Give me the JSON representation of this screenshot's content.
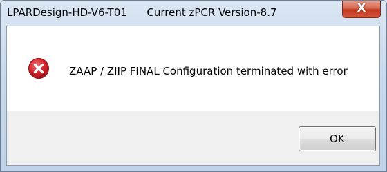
{
  "window": {
    "title": "LPARDesign-HD-V6-T01      Current zPCR Version-8.7",
    "close_glyph": "X",
    "close_icon": "close-icon"
  },
  "dialog": {
    "icon": "error-icon",
    "message": "ZAAP / ZIIP FINAL Configuration terminated with error",
    "ok_label": "OK"
  },
  "colors": {
    "error_red": "#d3232b",
    "close_red": "#c23a1e"
  }
}
